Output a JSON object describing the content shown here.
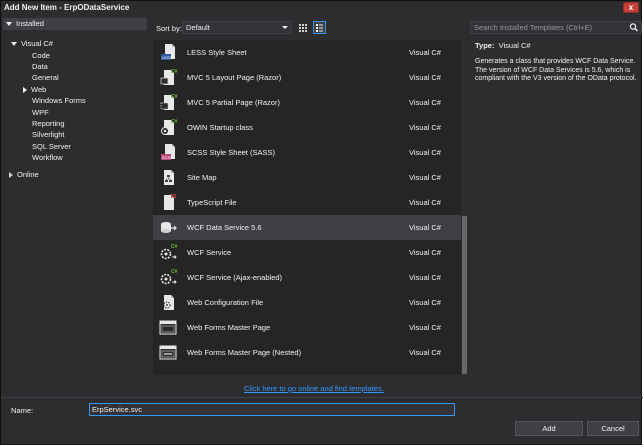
{
  "window": {
    "title": "Add New Item - ErpODataService",
    "close_glyph": "x"
  },
  "tree": {
    "installed": "Installed",
    "visual_csharp": "Visual C#",
    "children": [
      "Code",
      "Data",
      "General",
      "Web",
      "Windows Forms",
      "WPF",
      "Reporting",
      "Silverlight",
      "SQL Server",
      "Workflow"
    ],
    "online": "Online"
  },
  "toolbar": {
    "sort_label": "Sort by:",
    "sort_value": "Default",
    "search_placeholder": "Search Installed Templates (Ctrl+E)"
  },
  "templates": [
    {
      "name": "LESS Style Sheet",
      "lang": "Visual C#",
      "icon": "less-icon"
    },
    {
      "name": "MVC 5 Layout Page (Razor)",
      "lang": "Visual C#",
      "icon": "razor-layout-icon"
    },
    {
      "name": "MVC 5 Partial Page (Razor)",
      "lang": "Visual C#",
      "icon": "razor-partial-icon"
    },
    {
      "name": "OWIN Startup class",
      "lang": "Visual C#",
      "icon": "owin-icon"
    },
    {
      "name": "SCSS Style Sheet (SASS)",
      "lang": "Visual C#",
      "icon": "scss-icon"
    },
    {
      "name": "Site Map",
      "lang": "Visual C#",
      "icon": "sitemap-icon"
    },
    {
      "name": "TypeScript File",
      "lang": "Visual C#",
      "icon": "typescript-icon"
    },
    {
      "name": "WCF Data Service 5.6",
      "lang": "Visual C#",
      "icon": "wcf-data-service-icon"
    },
    {
      "name": "WCF Service",
      "lang": "Visual C#",
      "icon": "wcf-service-icon"
    },
    {
      "name": "WCF Service (Ajax-enabled)",
      "lang": "Visual C#",
      "icon": "wcf-ajax-icon"
    },
    {
      "name": "Web Configuration File",
      "lang": "Visual C#",
      "icon": "web-config-icon"
    },
    {
      "name": "Web Forms Master Page",
      "lang": "Visual C#",
      "icon": "master-page-icon"
    },
    {
      "name": "Web Forms Master Page (Nested)",
      "lang": "Visual C#",
      "icon": "nested-master-page-icon"
    }
  ],
  "selected_template": "WCF Data Service 5.6",
  "details": {
    "type_label": "Type:",
    "type_value": "Visual C#",
    "description": "Generates a class that provides WCF Data Service. The version of WCF Data Services is 5.6, which is compliant with the V3 version of the OData protocol."
  },
  "online_link": "Click here to go online and find templates.",
  "name_field": {
    "label": "Name:",
    "value": "ErpService.svc"
  },
  "buttons": {
    "add": "Add",
    "cancel": "Cancel"
  },
  "colors": {
    "background": "#2d2d30",
    "list": "#252526",
    "selection": "#3f3f46",
    "accent": "#3399ff",
    "close": "#c4413a"
  }
}
